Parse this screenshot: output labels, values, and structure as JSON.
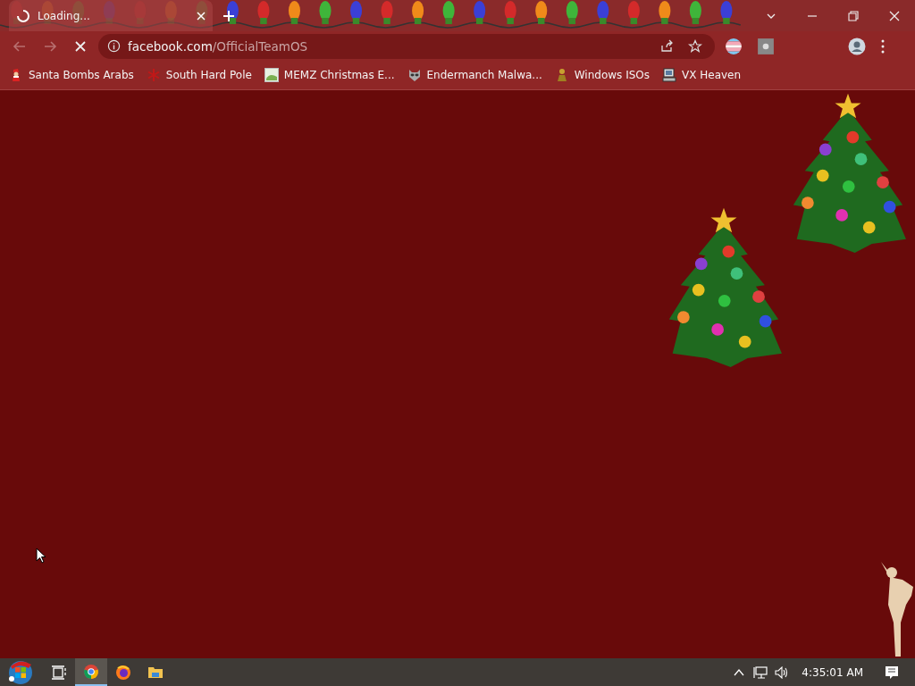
{
  "tab": {
    "title": "Loading...",
    "loading": true
  },
  "address": {
    "host": "facebook.com",
    "path": "/OfficialTeamOS"
  },
  "bookmarks": [
    {
      "label": "Santa Bombs Arabs"
    },
    {
      "label": "South Hard Pole"
    },
    {
      "label": "MEMZ Christmas E..."
    },
    {
      "label": "Endermanch Malwa..."
    },
    {
      "label": "Windows ISOs"
    },
    {
      "label": "VX Heaven"
    }
  ],
  "taskbar": {
    "apps": [
      {
        "kind": "task-view",
        "selected": false
      },
      {
        "kind": "chrome",
        "selected": true
      },
      {
        "kind": "firefox",
        "selected": false
      },
      {
        "kind": "folder",
        "selected": false
      }
    ],
    "clock": "4:35:01 AM"
  }
}
